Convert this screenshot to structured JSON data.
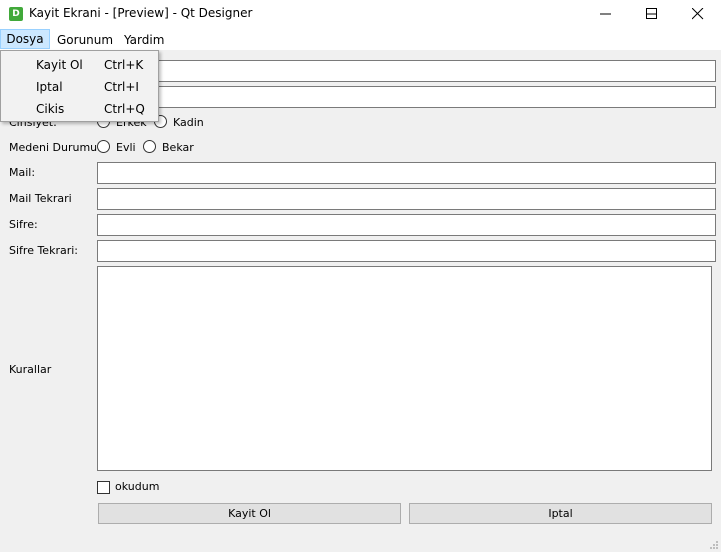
{
  "window": {
    "title": "Kayit Ekrani - [Preview] - Qt Designer",
    "icon_letter": "D",
    "icon_color": "#41a93a"
  },
  "menubar": {
    "items": [
      {
        "label": "Dosya",
        "active": true
      },
      {
        "label": "Gorunum"
      },
      {
        "label": "Yardim"
      }
    ]
  },
  "dropdown": {
    "items": [
      {
        "label": "Kayit Ol",
        "shortcut": "Ctrl+K"
      },
      {
        "label": "Iptal",
        "shortcut": "Ctrl+I"
      },
      {
        "label": "Cikis",
        "shortcut": "Ctrl+Q"
      }
    ]
  },
  "form": {
    "ad_value": "",
    "soyad_value": "",
    "cinsiyet_label": "Cinsiyet:",
    "erkek_label": "Erkek",
    "kadin_label": "Kadin",
    "medeni_label": "Medeni Durumu:",
    "evli_label": "Evli",
    "bekar_label": "Bekar",
    "mail_label": "Mail:",
    "mail_value": "",
    "mail_tekrari_label": "Mail Tekrari",
    "mail_tekrari_value": "",
    "sifre_label": "Sifre:",
    "sifre_value": "",
    "sifre_tekrari_label": "Sifre Tekrari:",
    "sifre_tekrari_value": "",
    "kurallar_label": "Kurallar",
    "kurallar_value": "",
    "okudum_label": "okudum",
    "okudum_checked": false,
    "kayit_button": "Kayit Ol",
    "iptal_button": "Iptal"
  }
}
